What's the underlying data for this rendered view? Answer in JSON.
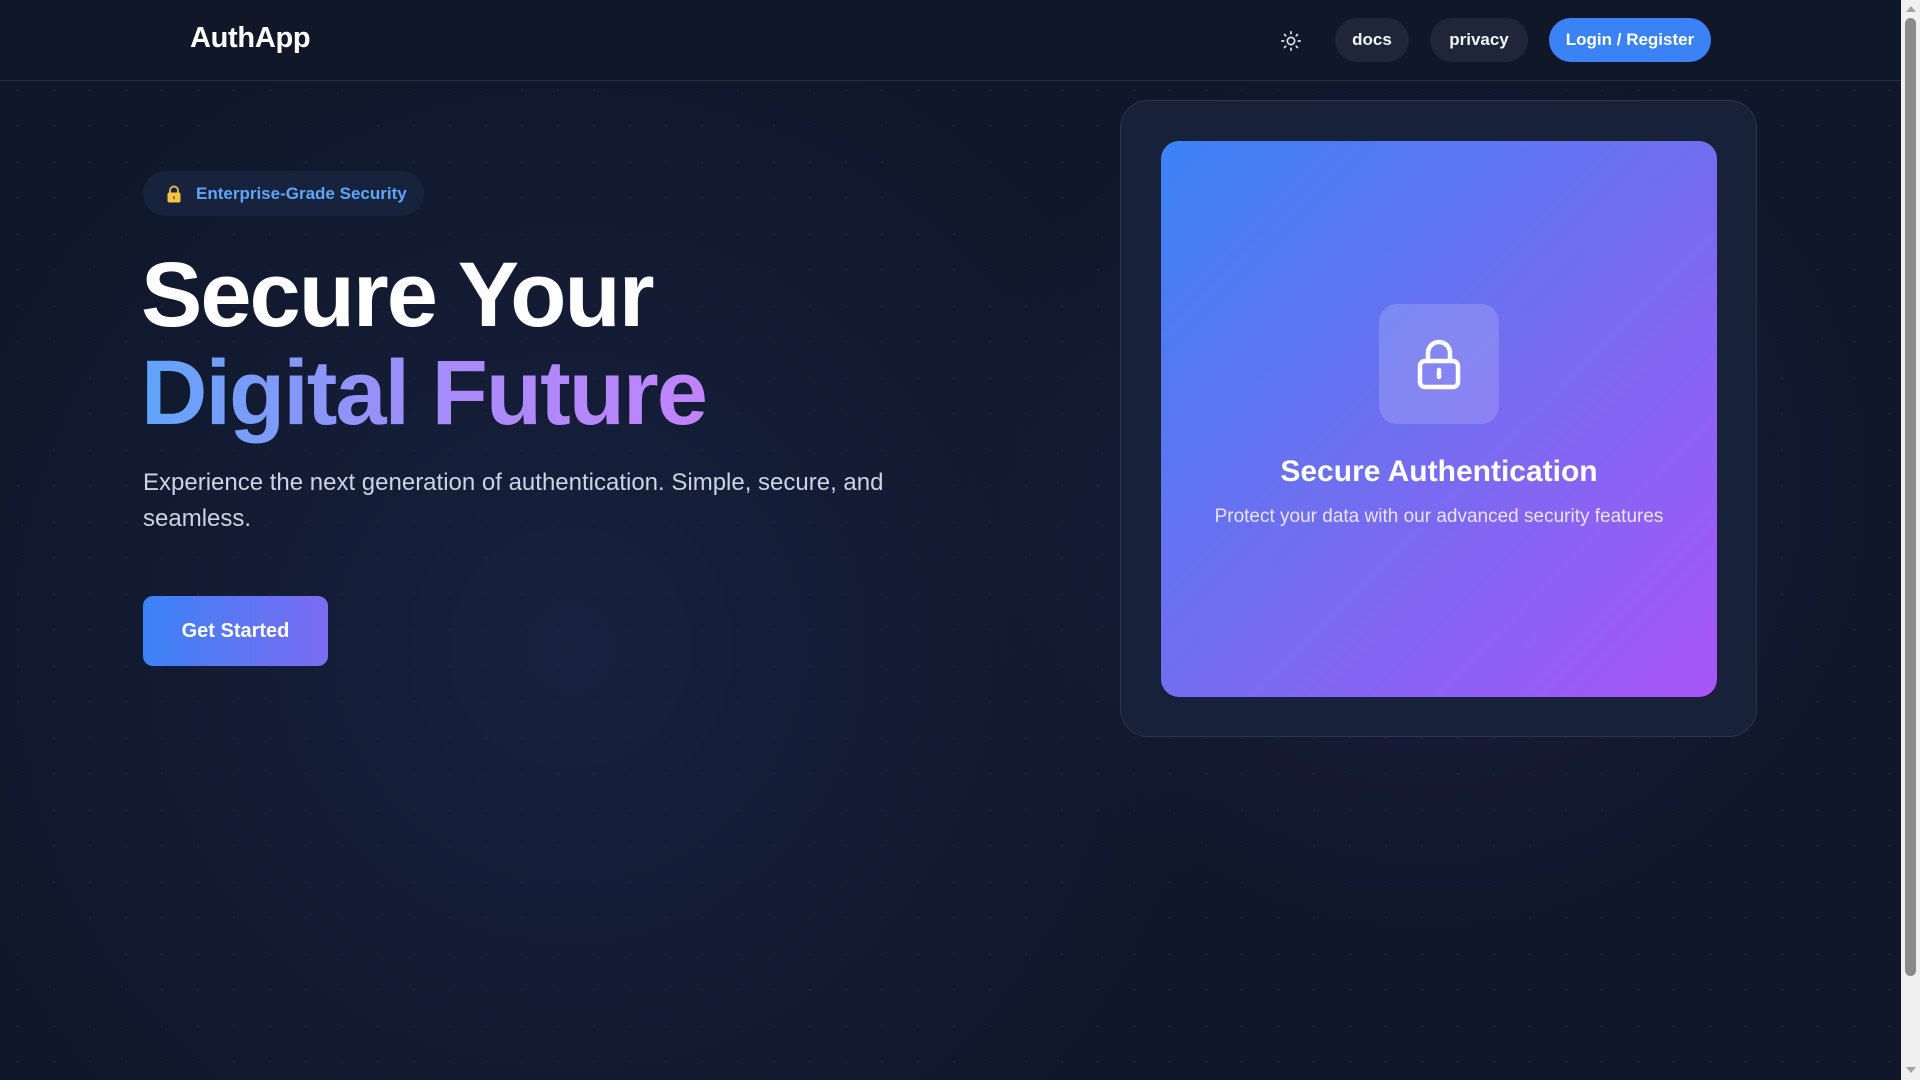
{
  "header": {
    "brand": "AuthApp",
    "theme_toggle_icon": "sun-icon",
    "nav": [
      {
        "label": "docs"
      },
      {
        "label": "privacy"
      }
    ],
    "login_label": "Login / Register"
  },
  "hero": {
    "badge": {
      "icon": "lock-icon",
      "text": "Enterprise-Grade Security"
    },
    "headline_line1": "Secure Your",
    "headline_line2": "Digital Future",
    "lead": "Experience the next generation of authentication. Simple, secure, and seamless.",
    "cta_label": "Get Started"
  },
  "feature_card": {
    "icon": "lock-icon",
    "title": "Secure Authentication",
    "description": "Protect your data with our advanced security features"
  },
  "colors": {
    "background": "#0f172a",
    "accent_blue": "#3b82f6",
    "accent_purple": "#a855f7",
    "badge_text": "#60a5fa"
  }
}
